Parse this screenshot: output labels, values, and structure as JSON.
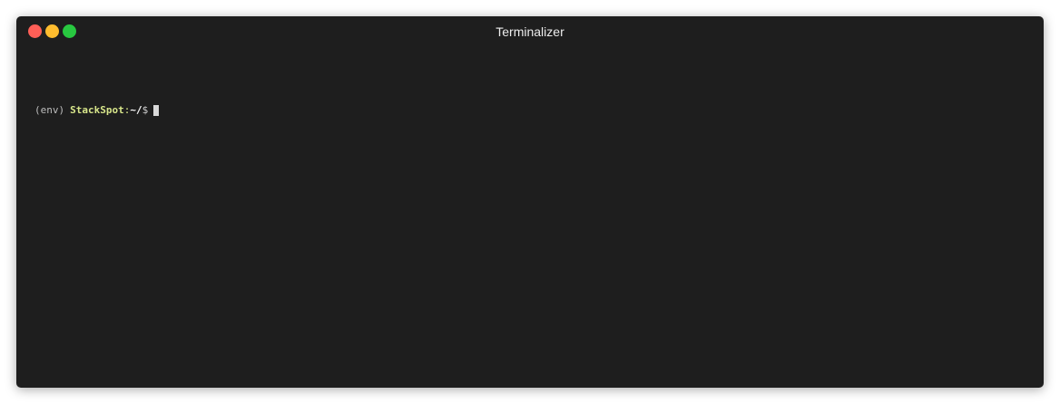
{
  "window": {
    "title": "Terminalizer"
  },
  "terminal": {
    "env": "(env)",
    "host": "StackSpot",
    "colon": ":",
    "path": "~/",
    "prompt_symbol": "$"
  },
  "colors": {
    "background": "#1e1e1e",
    "close": "#ff5f57",
    "minimize": "#febc2e",
    "maximize": "#28c840",
    "host": "#d7e58a"
  }
}
